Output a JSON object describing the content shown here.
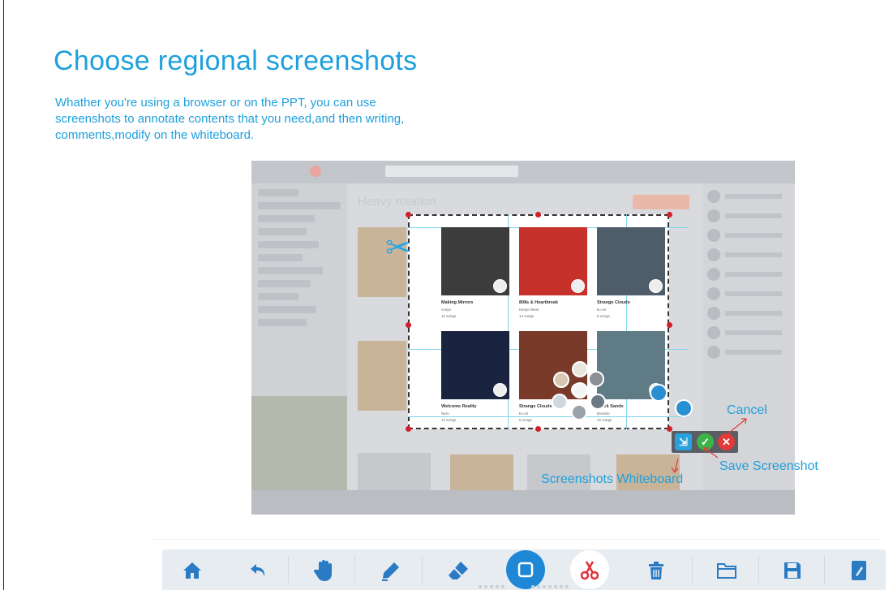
{
  "heading": "Choose regional screenshots",
  "description_lines": [
    "Whather you're using a browser or on the PPT, you can use",
    "screenshots to annotate contents that you need,and then writing,",
    "comments,modify on the whiteboard."
  ],
  "screenshot": {
    "page_heading": "Heavy rotation",
    "cards": [
      {
        "title": "Making Mirrors",
        "artist": "Gotye",
        "songs": "12 songs",
        "color": "#3c3c3c"
      },
      {
        "title": "808s & Heartbreak",
        "artist": "Kanye West",
        "songs": "14 songs",
        "color": "#c7312c"
      },
      {
        "title": "Strange Clouds",
        "artist": "B.o.B",
        "songs": "6 songs",
        "color": "#4f5d6b"
      },
      {
        "title": "Welcome Reality",
        "artist": "Nero",
        "songs": "14 songs",
        "color": "#1a2340"
      },
      {
        "title": "Strange Clouds",
        "artist": "B.o.B",
        "songs": "5 songs",
        "color": "#7a3a2a"
      },
      {
        "title": "Black Sands",
        "artist": "Bonobo",
        "songs": "12 songs",
        "color": "#5f7c86"
      }
    ]
  },
  "annotations": {
    "cancel": "Cancel",
    "save": "Save Screenshot",
    "whiteboard": "Screenshots Whiteboard"
  },
  "colors": {
    "accent": "#1ea0dc",
    "toolbar": "#e7ecf1",
    "icon": "#2a7bc4",
    "cut": "#e0313b"
  },
  "toolbar": {
    "icons": [
      "home-icon",
      "undo-icon",
      "hand-icon",
      "pen-icon",
      "eraser-icon",
      "shape-icon",
      "scissors-icon",
      "trash-icon",
      "folder-icon",
      "save-icon",
      "note-icon"
    ]
  }
}
